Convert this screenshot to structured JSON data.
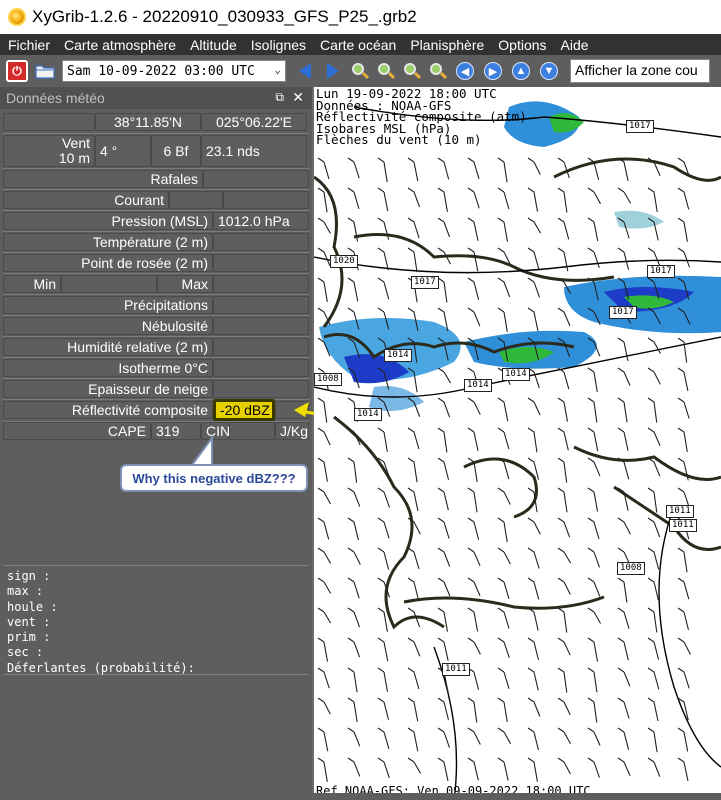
{
  "window": {
    "title": "XyGrib-1.2.6 - 20220910_030933_GFS_P25_.grb2"
  },
  "menu": [
    "Fichier",
    "Carte atmosphère",
    "Altitude",
    "Isolignes",
    "Carte océan",
    "Planisphère",
    "Options",
    "Aide"
  ],
  "toolbar": {
    "date_value": "Sam 10-09-2022 03:00 UTC",
    "zone_button": "Afficher la zone cou"
  },
  "panel": {
    "title": "Données météo",
    "lat": "38°11.85'N",
    "lon": "025°06.22'E",
    "vent_label": "Vent\n10 m",
    "vent_dir": "4 °",
    "vent_bf": "6 Bf",
    "vent_speed": "23.1  nds",
    "rafales": "Rafales",
    "courant": "Courant",
    "pression_label": "Pression (MSL)",
    "pression_value": "1012.0 hPa",
    "temperature": "Température (2 m)",
    "rosee": "Point de rosée (2 m)",
    "min": "Min",
    "max": "Max",
    "precipitations": "Précipitations",
    "nebulosite": "Nébulosité",
    "humidite": "Humidité relative (2 m)",
    "isotherme": "Isotherme 0°C",
    "neige": "Epaisseur de neige",
    "reflectivite_label": "Réflectivité composite",
    "reflectivite_value": "-20 dBZ",
    "cape_label": "CAPE",
    "cape_value": "319",
    "cin_label": "CIN",
    "cin_unit": "J/Kg",
    "sea_lines": [
      "sign :",
      "max :",
      "houle :",
      "vent :",
      "prim :",
      "sec :",
      "Déferlantes (probabilité):"
    ]
  },
  "annotation": {
    "callout_text": "Why this negative dBZ???",
    "highlight_color": "#e6d000"
  },
  "map": {
    "info_lines": [
      "Lun 19-09-2022 18:00 UTC",
      "Données : NOAA-GFS",
      "Réflectivité composite (atm)",
      "Isobares MSL (hPa)",
      "Flèches du vent (10 m)"
    ],
    "iso_labels": [
      "1017",
      "1020",
      "1017",
      "1017",
      "1017",
      "1014",
      "1014",
      "1014",
      "1014",
      "1011",
      "1011",
      "1008",
      "1011",
      "1008"
    ],
    "ref_text": "Ref NOAA-GFS: Ven 09-09-2022 18:00 UTC"
  }
}
